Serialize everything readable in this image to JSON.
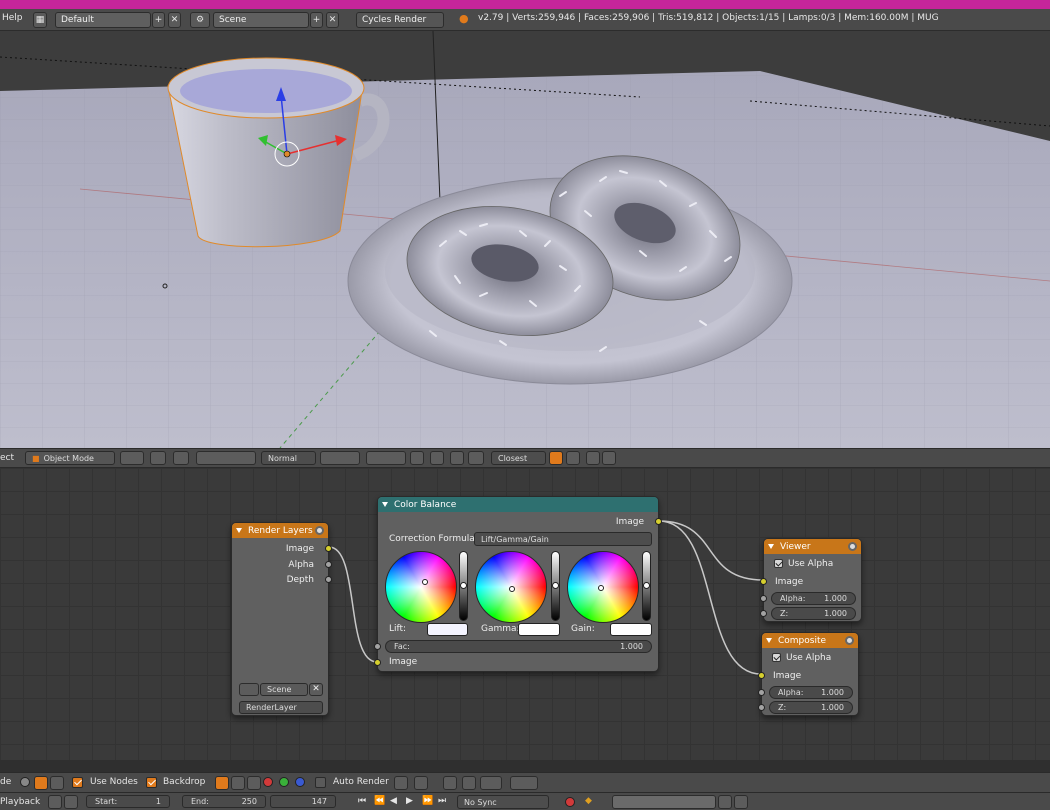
{
  "top_bar": {
    "help_menu": "Help",
    "screen_layout": "Default",
    "scene_name": "Scene",
    "render_engine": "Cycles Render",
    "stats": "v2.79 | Verts:259,946 | Faces:259,906 | Tris:519,812 | Objects:1/15 | Lamps:0/3 | Mem:160.00M | MUG"
  },
  "view3d_header": {
    "select_menu": "ect",
    "mode": "Object Mode",
    "pivot": "Normal",
    "snap_target": "Closest"
  },
  "nodes": {
    "render_layers": {
      "title": "Render Layers",
      "outputs": [
        "Image",
        "Alpha",
        "Depth"
      ],
      "scene": "Scene",
      "layer": "RenderLayer"
    },
    "color_balance": {
      "title": "Color Balance",
      "output": "Image",
      "correction_label": "Correction Formula:",
      "correction_value": "Lift/Gamma/Gain",
      "lift_label": "Lift:",
      "gamma_label": "Gamma:",
      "gain_label": "Gain:",
      "fac_label": "Fac:",
      "fac_value": "1.000",
      "input": "Image"
    },
    "viewer": {
      "title": "Viewer",
      "use_alpha": "Use Alpha",
      "input": "Image",
      "alpha_label": "Alpha:",
      "alpha_value": "1.000",
      "z_label": "Z:",
      "z_value": "1.000"
    },
    "composite": {
      "title": "Composite",
      "use_alpha": "Use Alpha",
      "input": "Image",
      "alpha_label": "Alpha:",
      "alpha_value": "1.000",
      "z_label": "Z:",
      "z_value": "1.000"
    }
  },
  "node_header": {
    "mode_label": "de",
    "use_nodes": "Use Nodes",
    "backdrop": "Backdrop",
    "auto_render": "Auto Render"
  },
  "timeline": {
    "playback": "Playback",
    "start_label": "Start:",
    "start_value": "1",
    "end_label": "End:",
    "end_value": "250",
    "current_frame": "147",
    "sync": "No Sync"
  },
  "colors": {
    "accent_orange": "#c87619",
    "node_teal": "#2e7070",
    "socket_yellow": "#d6cf2e",
    "title_bar_magenta": "#c5259b"
  }
}
